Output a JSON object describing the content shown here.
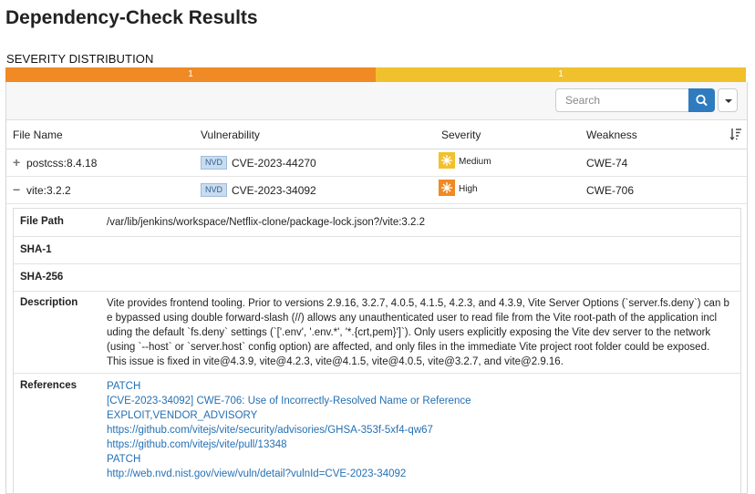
{
  "page": {
    "title": "Dependency-Check Results"
  },
  "severity": {
    "heading": "SEVERITY DISTRIBUTION",
    "segments": [
      {
        "level": "High",
        "count": "1",
        "fraction": 0.5,
        "color": "#ef8a24"
      },
      {
        "level": "Medium",
        "count": "1",
        "fraction": 0.5,
        "color": "#f0c12c"
      }
    ]
  },
  "search": {
    "placeholder": "Search",
    "icon": "search-icon"
  },
  "table": {
    "columns": [
      "File Name",
      "Vulnerability",
      "Severity",
      "Weakness"
    ],
    "sort_icon": "sort-icon",
    "rows": [
      {
        "toggle": "+",
        "file": "postcss:8.4.18",
        "source": "NVD",
        "cve": "CVE-2023-44270",
        "severity": "Medium",
        "weakness": "CWE-74"
      },
      {
        "toggle": "−",
        "file": "vite:3.2.2",
        "source": "NVD",
        "cve": "CVE-2023-34092",
        "severity": "High",
        "weakness": "CWE-706"
      }
    ]
  },
  "detail": {
    "file_path_label": "File Path",
    "file_path": "/var/lib/jenkins/workspace/Netflix-clone/package-lock.json?/vite:3.2.2",
    "sha1_label": "SHA-1",
    "sha1": "",
    "sha256_label": "SHA-256",
    "sha256": "",
    "description_label": "Description",
    "description_lines": [
      "Vite provides frontend tooling. Prior to versions 2.9.16, 3.2.7, 4.0.5, 4.1.5, 4.2.3, and 4.3.9, Vite Server Options (`server.fs.deny`) can b",
      "e bypassed using double forward-slash (//) allows any unauthenticated user to read file from the Vite root-path of the application incl",
      "uding the default `fs.deny` settings (`['.env', '.env.*', '*.{crt,pem}']`). Only users explicitly exposing the Vite dev server to the network",
      "(using `--host` or `server.host` config option) are affected, and only files in the immediate Vite project root folder could be exposed.",
      "This issue is fixed in vite@4.3.9, vite@4.2.3, vite@4.1.5, vite@4.0.5, vite@3.2.7, and vite@2.9.16."
    ],
    "references_label": "References",
    "references": [
      "PATCH",
      "[CVE-2023-34092] CWE-706: Use of Incorrectly-Resolved Name or Reference",
      "EXPLOIT,VENDOR_ADVISORY",
      "https://github.com/vitejs/vite/security/advisories/GHSA-353f-5xf4-qw67",
      "https://github.com/vitejs/vite/pull/13348",
      "PATCH",
      "http://web.nvd.nist.gov/view/vuln/detail?vulnId=CVE-2023-34092"
    ]
  }
}
